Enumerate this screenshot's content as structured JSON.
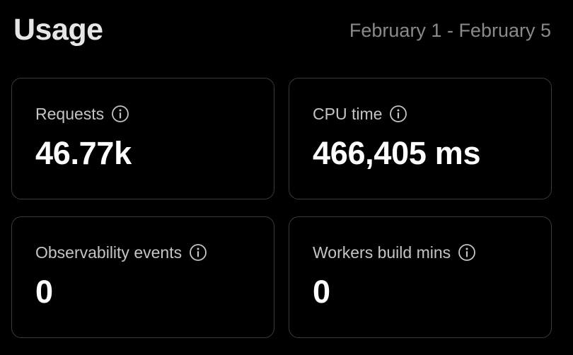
{
  "header": {
    "title": "Usage",
    "date_range": "February 1 - February 5"
  },
  "cards": [
    {
      "label": "Requests",
      "value": "46.77k",
      "icon": "info-icon"
    },
    {
      "label": "CPU time",
      "value": "466,405 ms",
      "icon": "info-icon"
    },
    {
      "label": "Observability events",
      "value": "0",
      "icon": "info-icon"
    },
    {
      "label": "Workers build mins",
      "value": "0",
      "icon": "info-icon"
    }
  ],
  "colors": {
    "background": "#000000",
    "card_border": "#3a3a3a",
    "title": "#e6e6e6",
    "muted_text": "#8a8a8a",
    "label_text": "#c4c4c4",
    "value_text": "#ffffff"
  }
}
